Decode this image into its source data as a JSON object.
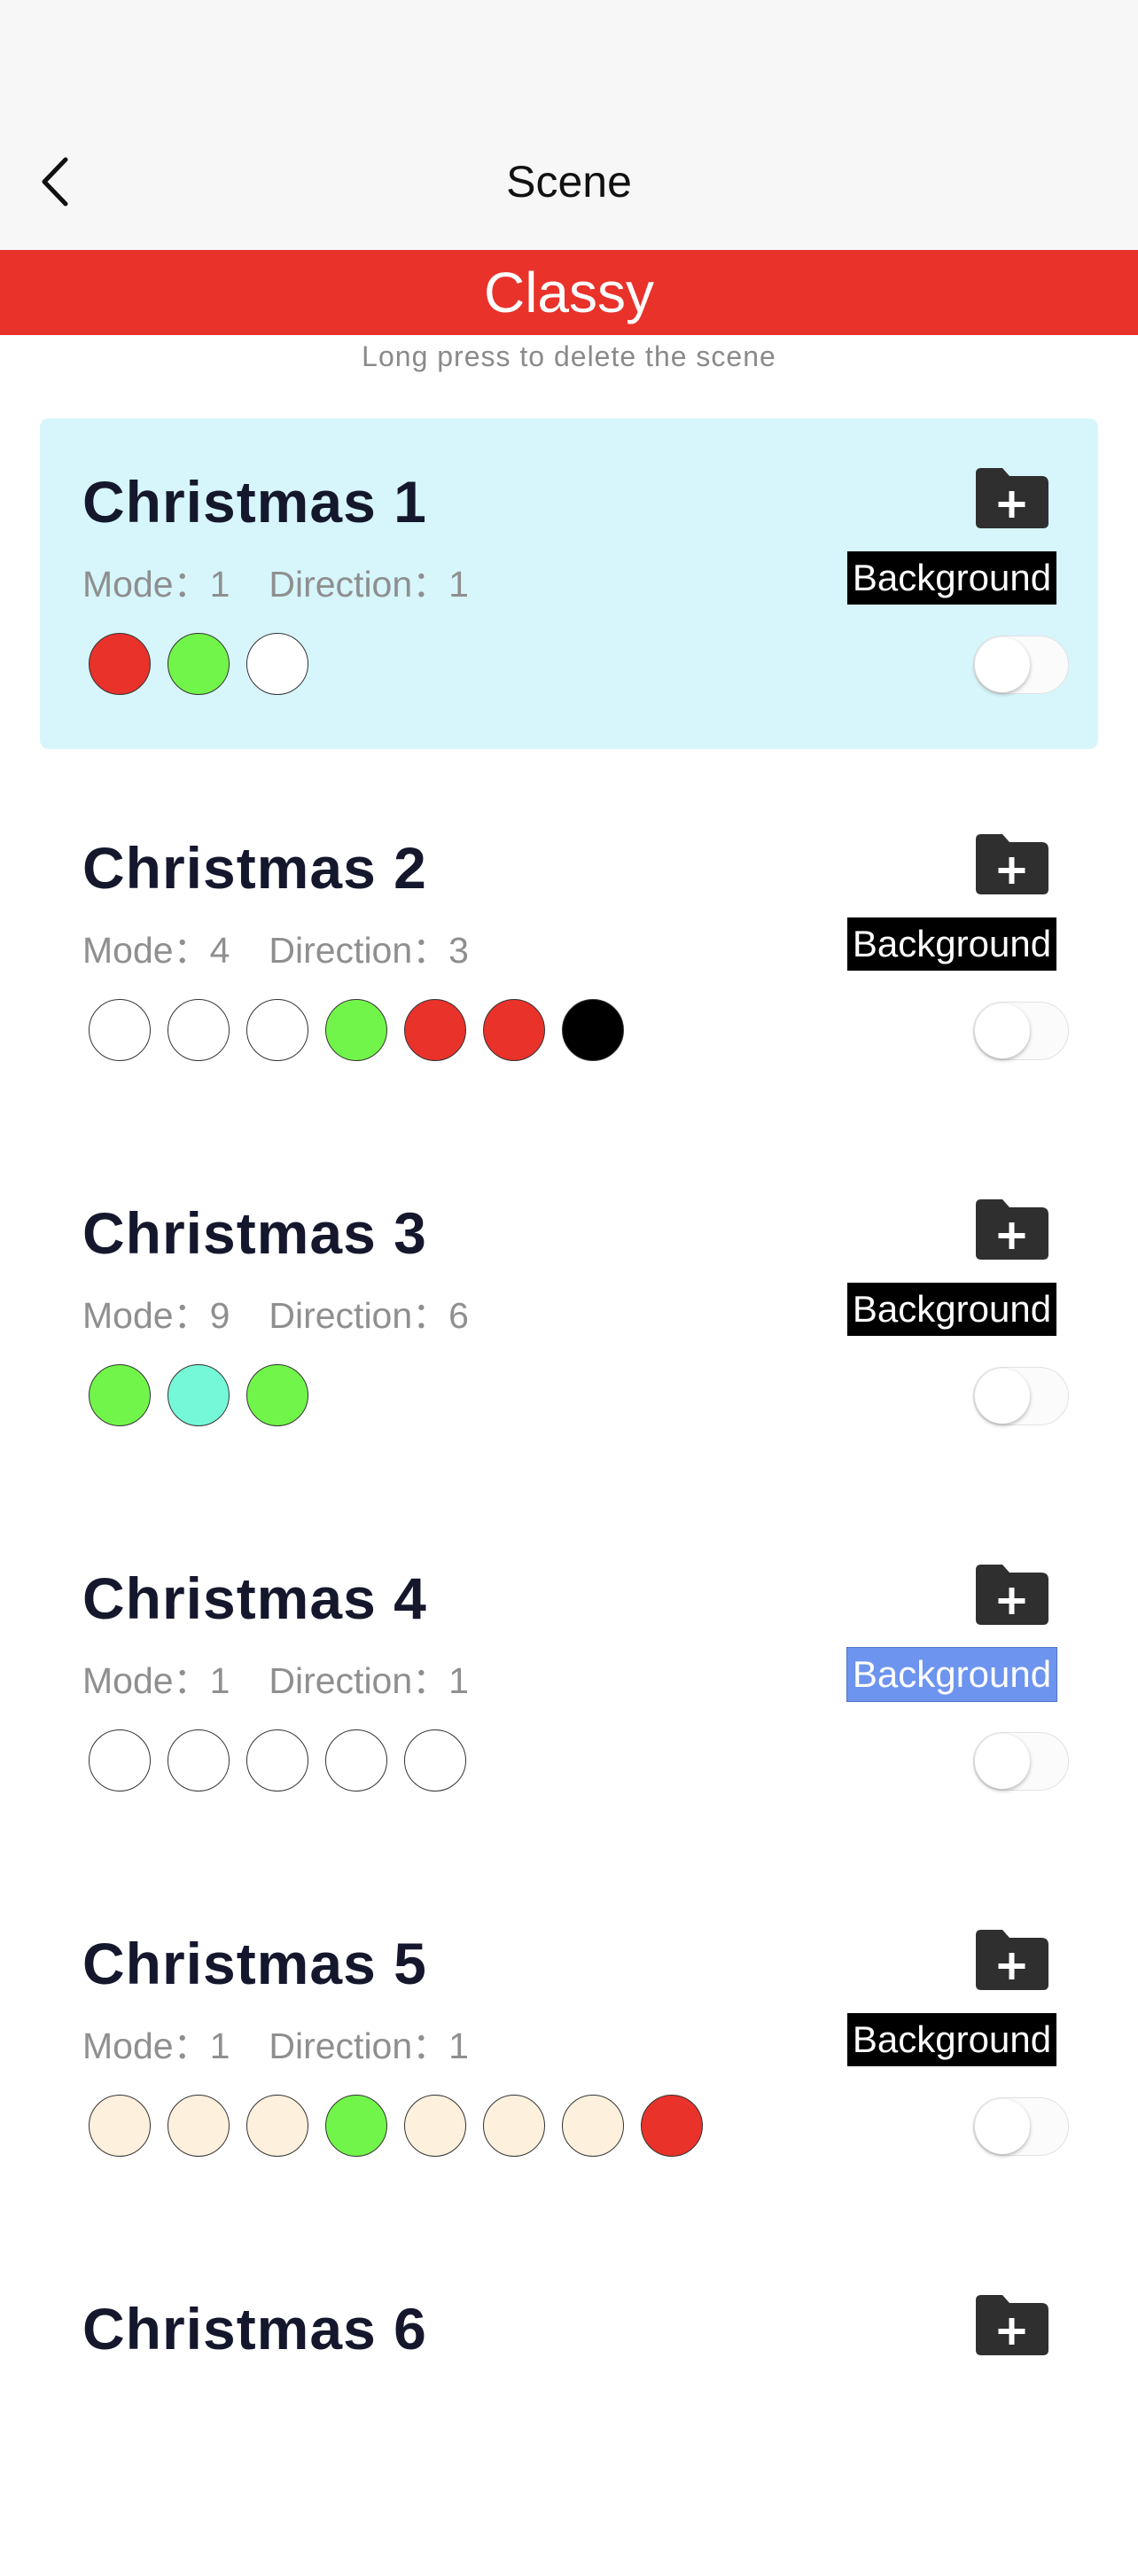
{
  "nav": {
    "title": "Scene",
    "back_icon": "chevron-left-icon"
  },
  "category": {
    "title": "Classy"
  },
  "hint": "Long press to delete the scene",
  "labels": {
    "mode": "Mode：",
    "direction": "Direction：",
    "background": "Background"
  },
  "add_icon": "folder-plus-icon",
  "colors": {
    "banner": "#e9322a",
    "selected_card": "#d6f6fb",
    "title_text": "#15182d"
  },
  "scenes": [
    {
      "name": "Christmas 1",
      "mode": "1",
      "direction": "1",
      "selected": true,
      "enabled": false,
      "background_highlighted": false,
      "swatches": [
        "#e9322a",
        "#72f54a",
        "#ffffff"
      ]
    },
    {
      "name": "Christmas 2",
      "mode": "4",
      "direction": "3",
      "selected": false,
      "enabled": false,
      "background_highlighted": false,
      "swatches": [
        "#ffffff",
        "#ffffff",
        "#ffffff",
        "#72f54a",
        "#e9322a",
        "#e9322a",
        "#000000"
      ]
    },
    {
      "name": "Christmas 3",
      "mode": "9",
      "direction": "6",
      "selected": false,
      "enabled": false,
      "background_highlighted": false,
      "swatches": [
        "#72f54a",
        "#75f8d8",
        "#72f54a"
      ]
    },
    {
      "name": "Christmas 4",
      "mode": "1",
      "direction": "1",
      "selected": false,
      "enabled": false,
      "background_highlighted": true,
      "swatches": [
        "#ffffff",
        "#ffffff",
        "#ffffff",
        "#ffffff",
        "#ffffff"
      ]
    },
    {
      "name": "Christmas 5",
      "mode": "1",
      "direction": "1",
      "selected": false,
      "enabled": false,
      "background_highlighted": false,
      "swatches": [
        "#fdf0dc",
        "#fdf0dc",
        "#fdf0dc",
        "#72f54a",
        "#fdf0dc",
        "#fdf0dc",
        "#fdf0dc",
        "#e9322a"
      ]
    },
    {
      "name": "Christmas 6",
      "partial": true
    }
  ]
}
